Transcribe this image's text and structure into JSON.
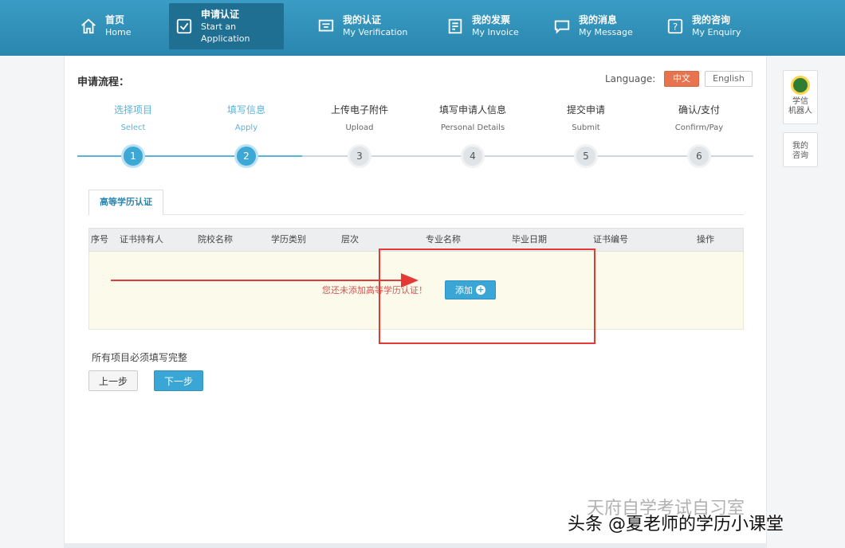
{
  "nav": {
    "items": [
      {
        "cn": "首页",
        "en": "Home",
        "icon": "home-icon",
        "active": false
      },
      {
        "cn": "申请认证",
        "en": "Start an Application",
        "icon": "checkbox-icon",
        "active": true
      },
      {
        "cn": "我的认证",
        "en": "My Verification",
        "icon": "certificate-icon",
        "active": false
      },
      {
        "cn": "我的发票",
        "en": "My Invoice",
        "icon": "invoice-icon",
        "active": false
      },
      {
        "cn": "我的消息",
        "en": "My Message",
        "icon": "message-icon",
        "active": false
      },
      {
        "cn": "我的咨询",
        "en": "My Enquiry",
        "icon": "enquiry-icon",
        "active": false
      }
    ]
  },
  "process": {
    "title": "申请流程：",
    "language_label": "Language:",
    "lang_zh": "中文",
    "lang_en": "English",
    "steps": [
      {
        "num": "1",
        "cn": "选择项目",
        "en": "Select",
        "state": "done"
      },
      {
        "num": "2",
        "cn": "填写信息",
        "en": "Apply",
        "state": "done"
      },
      {
        "num": "3",
        "cn": "上传电子附件",
        "en": "Upload",
        "state": "todo"
      },
      {
        "num": "4",
        "cn": "填写申请人信息",
        "en": "Personal Details",
        "state": "todo"
      },
      {
        "num": "5",
        "cn": "提交申请",
        "en": "Submit",
        "state": "todo"
      },
      {
        "num": "6",
        "cn": "确认/支付",
        "en": "Confirm/Pay",
        "state": "todo"
      }
    ]
  },
  "tab": {
    "label": "高等学历认证"
  },
  "table": {
    "columns": [
      "序号",
      "证书持有人",
      "院校名称",
      "学历类别",
      "层次",
      "专业名称",
      "毕业日期",
      "证书编号",
      "操作"
    ],
    "empty_message": "您还未添加高等学历认证！",
    "add_label": "添加"
  },
  "form": {
    "required_note": "所有项目必须填写完整",
    "prev_label": "上一步",
    "next_label": "下一步"
  },
  "side": {
    "robot_label_1": "学信",
    "robot_label_2": "机器人",
    "enquiry_label_1": "我的",
    "enquiry_label_2": "咨询"
  },
  "watermark": {
    "text": "头条 @夏老师的学历小课堂",
    "bg_text": "天府自学考试自习室"
  },
  "colors": {
    "nav_bg": "#2f8fb8",
    "accent": "#3aa6d6",
    "highlight": "#e53935",
    "lang_active": "#e8734f"
  }
}
